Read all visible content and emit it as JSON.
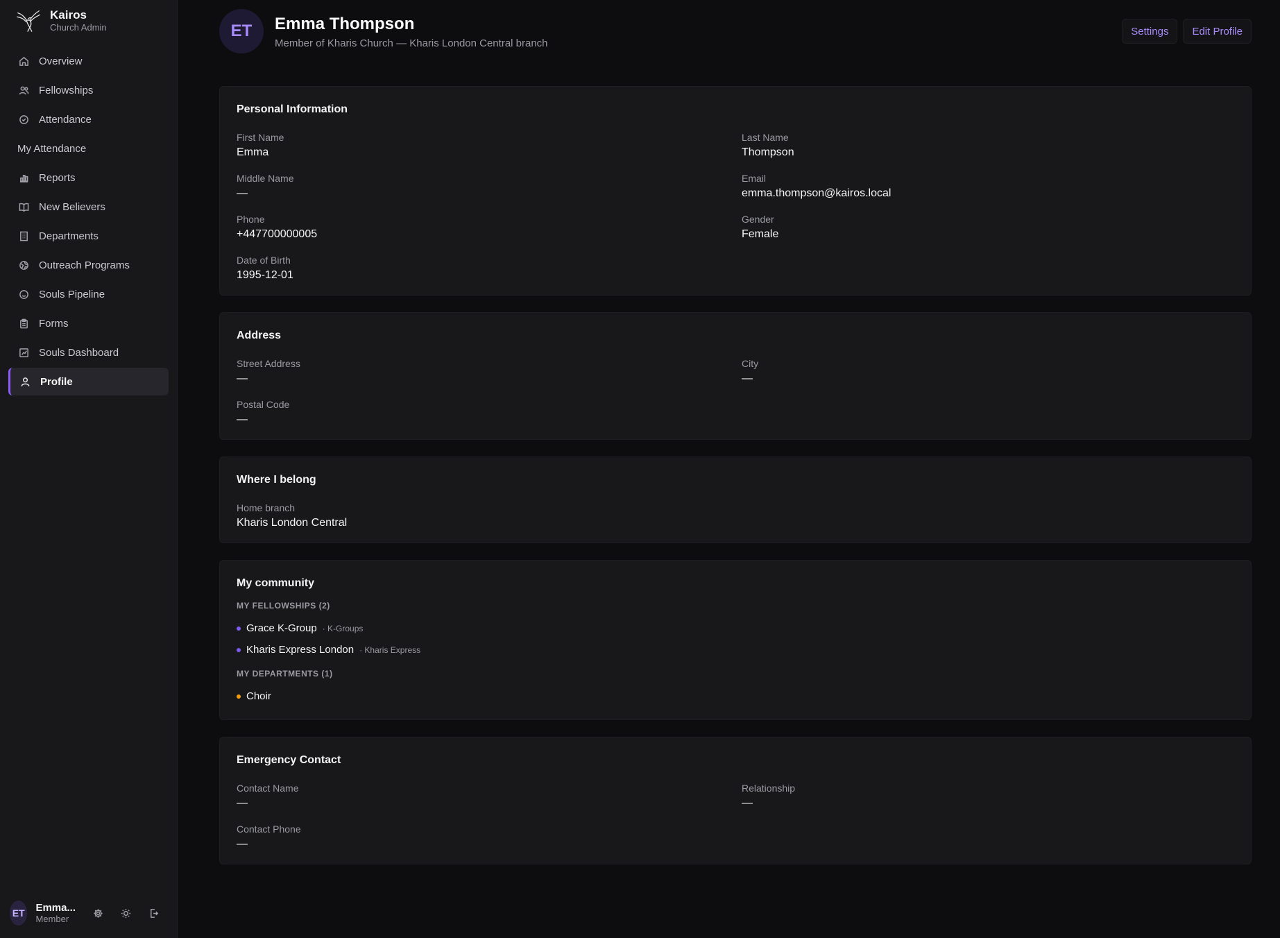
{
  "brand": {
    "name": "Kairos",
    "subtitle": "Church Admin",
    "logo_icon": "dove-icon"
  },
  "sidebar": {
    "items": [
      {
        "label": "Overview",
        "icon": "home-icon"
      },
      {
        "label": "Fellowships",
        "icon": "users-icon"
      },
      {
        "label": "Attendance",
        "icon": "check-circle-icon"
      },
      {
        "label": "My Attendance",
        "icon": ""
      },
      {
        "label": "Reports",
        "icon": "bar-chart-icon"
      },
      {
        "label": "New Believers",
        "icon": "book-icon"
      },
      {
        "label": "Departments",
        "icon": "building-icon"
      },
      {
        "label": "Outreach Programs",
        "icon": "globe-icon"
      },
      {
        "label": "Souls Pipeline",
        "icon": "smile-icon"
      },
      {
        "label": "Forms",
        "icon": "clipboard-icon"
      },
      {
        "label": "Souls Dashboard",
        "icon": "chart-box-icon"
      },
      {
        "label": "Profile",
        "icon": "user-icon",
        "active": true
      }
    ]
  },
  "user": {
    "initials": "ET",
    "name": "Emma...",
    "role": "Member"
  },
  "header": {
    "initials": "ET",
    "title": "Emma Thompson",
    "subtitle": "Member of Kharis Church — Kharis London Central branch",
    "settings_label": "Settings",
    "edit_label": "Edit Profile"
  },
  "personal": {
    "title": "Personal Information",
    "first_name_label": "First Name",
    "first_name": "Emma",
    "last_name_label": "Last Name",
    "last_name": "Thompson",
    "middle_name_label": "Middle Name",
    "middle_name": "—",
    "email_label": "Email",
    "email": "emma.thompson@kairos.local",
    "phone_label": "Phone",
    "phone": "+447700000005",
    "gender_label": "Gender",
    "gender": "Female",
    "dob_label": "Date of Birth",
    "dob": "1995-12-01"
  },
  "address": {
    "title": "Address",
    "street_label": "Street Address",
    "street": "—",
    "city_label": "City",
    "city": "—",
    "postal_label": "Postal Code",
    "postal": "—"
  },
  "belong": {
    "title": "Where I belong",
    "branch_label": "Home branch",
    "branch": "Kharis London Central"
  },
  "community": {
    "title": "My community",
    "fellowships_label": "MY FELLOWSHIPS (2)",
    "fellowships": [
      {
        "name": "Grace K-Group",
        "tag": "· K-Groups"
      },
      {
        "name": "Kharis Express London",
        "tag": "· Kharis Express"
      }
    ],
    "departments_label": "MY DEPARTMENTS (1)",
    "departments": [
      {
        "name": "Choir"
      }
    ],
    "colors": {
      "fellowship_dot": "#7c5cf0",
      "department_dot": "#f59e0b"
    }
  },
  "emergency": {
    "title": "Emergency Contact",
    "contact_name_label": "Contact Name",
    "contact_name": "—",
    "relationship_label": "Relationship",
    "relationship": "—",
    "contact_phone_label": "Contact Phone",
    "contact_phone": "—"
  },
  "colors": {
    "accent": "#8b5cf6",
    "link": "#a78bfa",
    "background": "#0d0d0f",
    "card": "#18181a"
  }
}
